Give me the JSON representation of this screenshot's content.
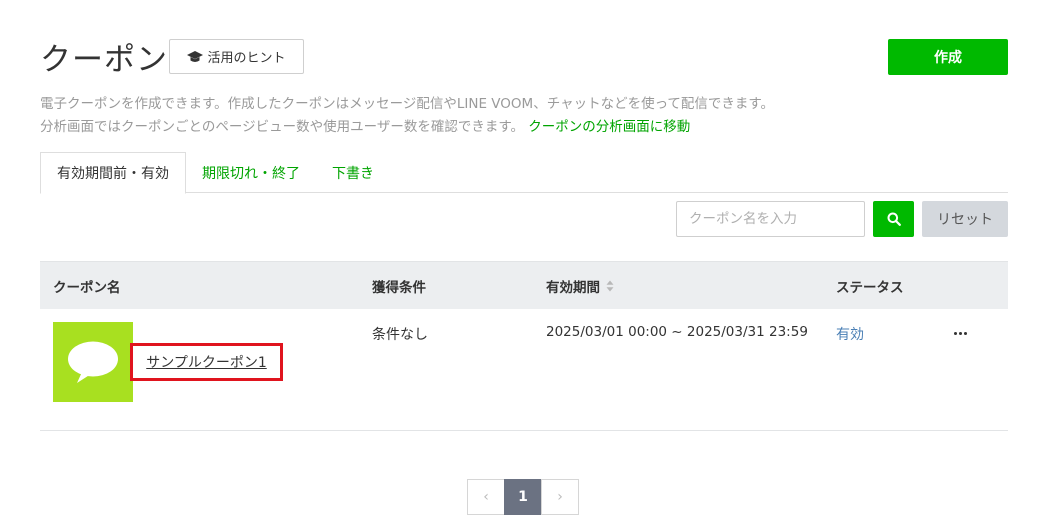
{
  "header": {
    "title": "クーポン",
    "hint_label": "活用のヒント",
    "create_label": "作成"
  },
  "description": {
    "line1": "電子クーポンを作成できます。作成したクーポンはメッセージ配信やLINE VOOM、チャットなどを使って配信できます。",
    "line2": "分析画面ではクーポンごとのページビュー数や使用ユーザー数を確認できます。",
    "analysis_link": "クーポンの分析画面に移動"
  },
  "tabs": [
    {
      "label": "有効期間前・有効",
      "active": true
    },
    {
      "label": "期限切れ・終了",
      "active": false
    },
    {
      "label": "下書き",
      "active": false
    }
  ],
  "search": {
    "placeholder": "クーポン名を入力",
    "value": "",
    "reset_label": "リセット"
  },
  "table": {
    "columns": [
      "クーポン名",
      "獲得条件",
      "有効期間",
      "ステータス"
    ],
    "rows": [
      {
        "name": "サンプルクーポン1",
        "condition": "条件なし",
        "period": "2025/03/01 00:00 ~ 2025/03/31 23:59",
        "status": "有効"
      }
    ]
  },
  "pagination": {
    "current": "1",
    "prev_symbol": "‹",
    "next_symbol": "›"
  },
  "colors": {
    "brand_green": "#00b900",
    "link_green": "#00a400",
    "thumb_green": "#a8e020",
    "status_blue": "#4a7fb5",
    "highlight_red": "#e0141e"
  },
  "icons": [
    "graduation-cap-icon",
    "search-icon",
    "sort-icon",
    "chat-bubble-icon",
    "more-icon",
    "chevron-left-icon",
    "chevron-right-icon"
  ]
}
